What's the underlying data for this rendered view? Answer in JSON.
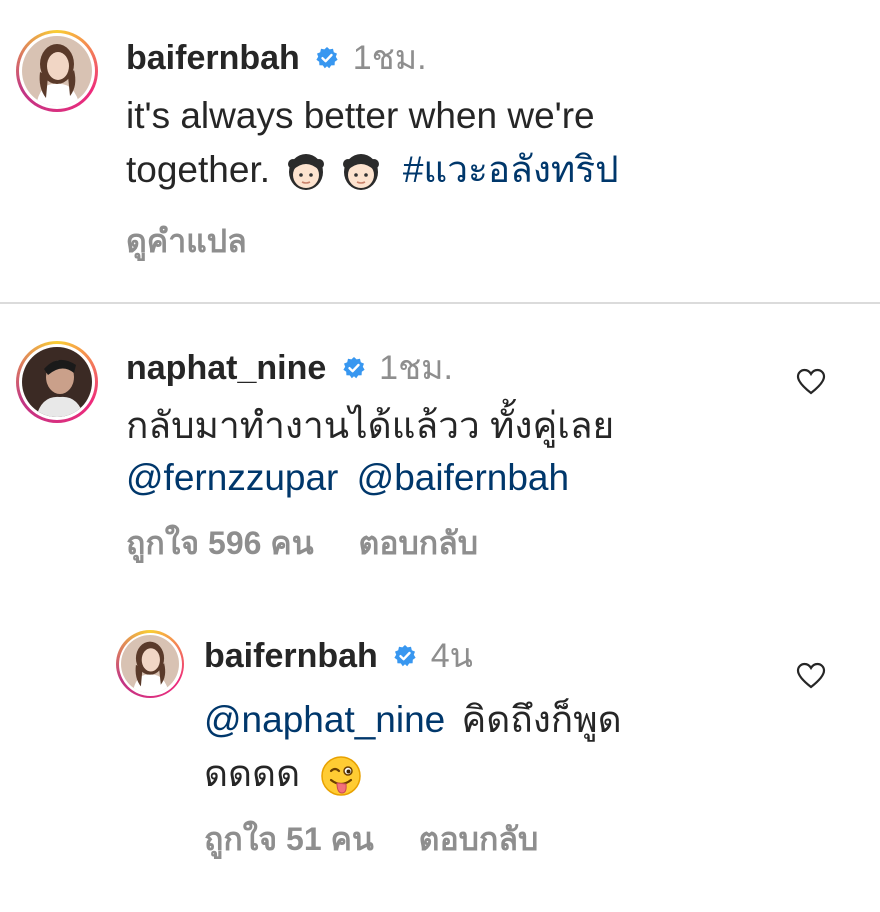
{
  "caption": {
    "username": "baifernbah",
    "time": "1ชม.",
    "text_line1": "it's always better when we're",
    "text_line2": "together.",
    "hashtag": "#แวะอลังทริป",
    "translate_label": "ดูคำแปล",
    "emoji_icons": [
      "girl-face-icon",
      "girl-face-icon"
    ]
  },
  "comments": [
    {
      "username": "naphat_nine",
      "time": "1ชม.",
      "text_line1": "กลับมาทำงานได้แล้วว ทั้งคู่เลย",
      "mention1": "@fernzzupar",
      "mention2": "@baifernbah",
      "likes_label": "ถูกใจ 596 คน",
      "reply_label": "ตอบกลับ"
    }
  ],
  "reply": {
    "username": "baifernbah",
    "time": "4น",
    "mention": "@naphat_nine",
    "text_after_mention": "คิดถึงก็พูด",
    "text_line2": "ดดดด",
    "emoji_icon": "winking-tongue-face-icon",
    "likes_label": "ถูกใจ 51 คน",
    "reply_label": "ตอบกลับ"
  },
  "colors": {
    "text": "#262626",
    "secondary": "#8e8e8e",
    "link": "#00376b",
    "verified": "#3897f0",
    "divider": "#dbdbdb"
  }
}
